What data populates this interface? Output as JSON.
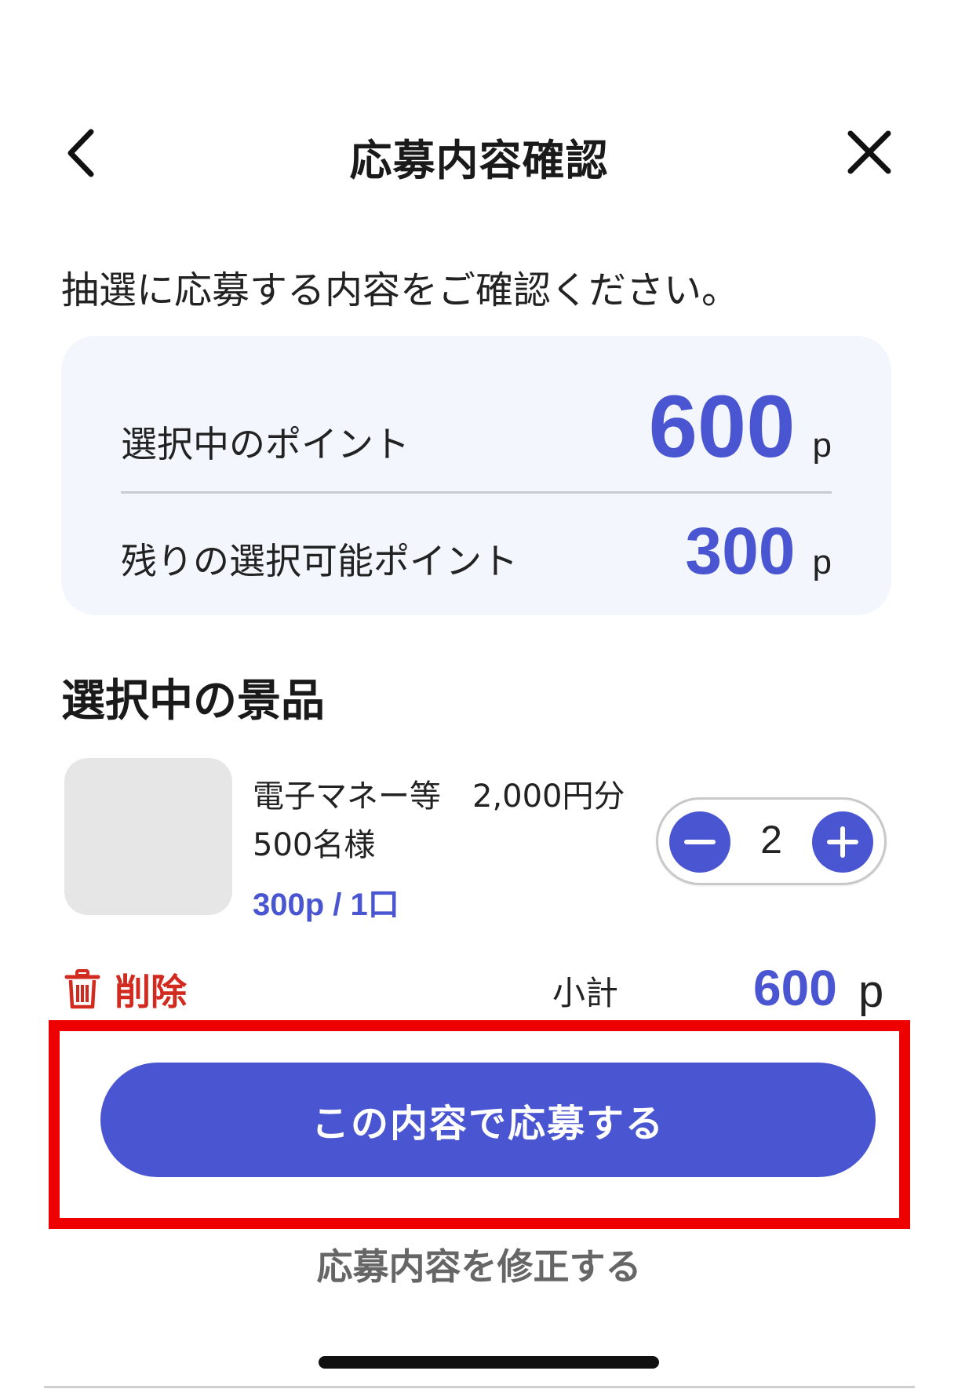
{
  "header": {
    "title": "応募内容確認",
    "back_icon": "chevron-left-icon",
    "close_icon": "close-icon"
  },
  "intro_text": "抽選に応募する内容をご確認ください。",
  "points": {
    "selected_label": "選択中のポイント",
    "selected_value": "600",
    "remaining_label": "残りの選択可能ポイント",
    "remaining_value": "300",
    "unit": "p"
  },
  "prizes_section_title": "選択中の景品",
  "prize": {
    "name": "電子マネー等　2,000円分",
    "winners": "500名様",
    "price": "300p / 1口",
    "quantity": "2"
  },
  "actions": {
    "delete_label": "削除",
    "subtotal_label": "小計",
    "subtotal_value": "600",
    "subtotal_unit": "p",
    "submit_label": "この内容で応募する",
    "edit_label": "応募内容を修正する"
  },
  "colors": {
    "accent": "#4a56d1",
    "danger": "#d22a1f",
    "highlight": "#ee0000",
    "card_bg": "#f3f6fd"
  }
}
